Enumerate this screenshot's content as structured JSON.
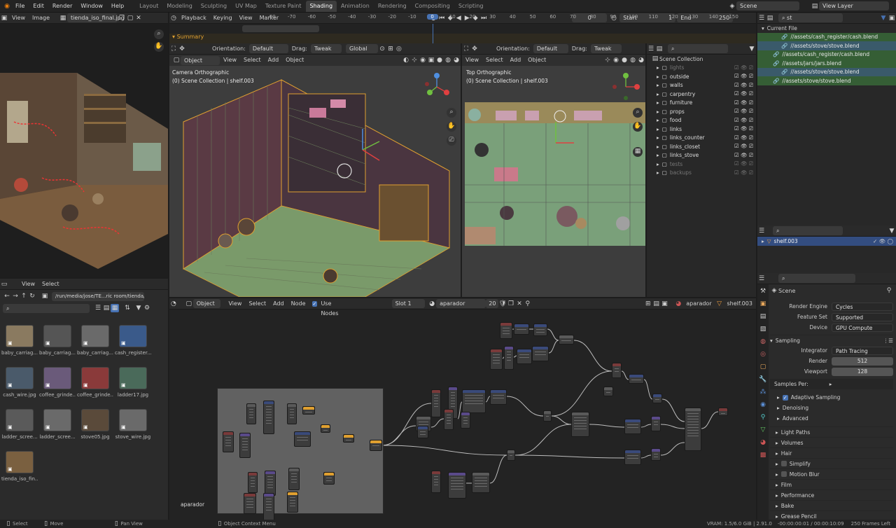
{
  "menubar": {
    "items": [
      "File",
      "Edit",
      "Render",
      "Window",
      "Help"
    ],
    "workspaces": [
      "Layout",
      "Modeling",
      "Sculpting",
      "UV Map",
      "Texture Paint",
      "Shading",
      "Animation",
      "Rendering",
      "Compositing",
      "Scripting"
    ],
    "active_workspace": "Shading",
    "scene": "Scene",
    "view_layer": "View Layer"
  },
  "image_editor": {
    "menus": [
      "View",
      "Image"
    ],
    "image_name": "tienda_iso_final.jpg"
  },
  "timeline": {
    "menus": [
      "Playback",
      "Keying",
      "View",
      "Marker"
    ],
    "current_frame": "0",
    "start_label": "Start",
    "start": "1",
    "end_label": "End",
    "end": "250",
    "ticks": [
      "-80",
      "-70",
      "-60",
      "-50",
      "-40",
      "-30",
      "-20",
      "-10",
      "0",
      "10",
      "20",
      "30",
      "40",
      "50",
      "60",
      "70",
      "80",
      "90",
      "100",
      "110",
      "120",
      "130",
      "140",
      "150"
    ],
    "playhead": "0",
    "summary": "Summary"
  },
  "viewport_left": {
    "orientation_label": "Orientation:",
    "orientation": "Default",
    "drag_label": "Drag:",
    "drag": "Tweak",
    "transform": "Global",
    "mode": "Object Mode",
    "menus": [
      "View",
      "Select",
      "Add",
      "Object"
    ],
    "view_name": "Camera Orthographic",
    "context": "(0) Scene Collection | shelf.003"
  },
  "viewport_right": {
    "orientation_label": "Orientation:",
    "orientation": "Default",
    "drag_label": "Drag:",
    "drag": "Tweak",
    "menus": [
      "View",
      "Select",
      "Add",
      "Object"
    ],
    "view_name": "Top Orthographic",
    "context": "(0) Scene Collection | shelf.003"
  },
  "outliner": {
    "root": "Scene Collection",
    "items": [
      {
        "name": "lights",
        "dim": true
      },
      {
        "name": "outside",
        "dim": false
      },
      {
        "name": "walls",
        "dim": false
      },
      {
        "name": "carpentry",
        "dim": false
      },
      {
        "name": "furniture",
        "dim": false
      },
      {
        "name": "props",
        "dim": false
      },
      {
        "name": "food",
        "dim": false
      },
      {
        "name": "links",
        "dim": false
      },
      {
        "name": "links_counter",
        "dim": false
      },
      {
        "name": "links_closet",
        "dim": false
      },
      {
        "name": "links_stove",
        "dim": false
      },
      {
        "name": "tests",
        "dim": true
      },
      {
        "name": "backups",
        "dim": true
      }
    ]
  },
  "blend_file_view": {
    "search": "st",
    "root": "Current File",
    "items": [
      {
        "text": "//assets/cash_register/cash.blend",
        "indent": 2,
        "highlight": true
      },
      {
        "text": "//assets/stove/stove.blend",
        "indent": 2,
        "highlight": false
      },
      {
        "text": "//assets/cash_register/cash.blend",
        "indent": 1,
        "highlight": true
      },
      {
        "text": "//assets/jars/jars.blend",
        "indent": 1,
        "highlight": true
      },
      {
        "text": "//assets/stove/stove.blend",
        "indent": 2,
        "highlight": false
      },
      {
        "text": "//assets/stove/stove.blend",
        "indent": 1,
        "highlight": true
      }
    ]
  },
  "object_panel": {
    "object": "shelf.003"
  },
  "properties": {
    "title": "Scene",
    "render_engine_label": "Render Engine",
    "render_engine": "Cycles",
    "feature_set_label": "Feature Set",
    "feature_set": "Supported",
    "device_label": "Device",
    "device": "GPU Compute",
    "sampling": "Sampling",
    "integrator_label": "Integrator",
    "integrator": "Path Tracing",
    "render_label": "Render",
    "render": "512",
    "viewport_label": "Viewport",
    "viewport": "128",
    "samples_per": "Samples Per:",
    "adaptive": "Adaptive Sampling",
    "denoising": "Denoising",
    "advanced": "Advanced",
    "sections": [
      "Light Paths",
      "Volumes",
      "Hair",
      "Simplify",
      "Motion Blur",
      "Film",
      "Performance",
      "Bake",
      "Grease Pencil"
    ]
  },
  "file_browser": {
    "menus": [
      "View",
      "Select"
    ],
    "path": "/run/media/jose/TE...ric room/tienda/rrss/",
    "files": [
      "baby_carriag...",
      "baby_carriag...",
      "baby_carriag...",
      "cash_register...",
      "cash_wire.jpg",
      "coffee_grinde...",
      "coffee_grinde...",
      "ladder17.jpg",
      "ladder_scree...",
      "ladder_scree...",
      "stove05.jpg",
      "stove_wire.jpg",
      "tienda_iso_fin..."
    ]
  },
  "node_editor": {
    "mode": "Object",
    "menus": [
      "View",
      "Select",
      "Add",
      "Node"
    ],
    "use_nodes": "Use Nodes",
    "slot": "Slot 1",
    "material": "aparador",
    "users": "20",
    "breadcrumb_material": "aparador",
    "breadcrumb_object": "shelf.003",
    "frame_label": "aparador"
  },
  "statusbar": {
    "select": "Select",
    "move": "Move",
    "pan": "Pan View",
    "context_menu": "Object Context Menu",
    "stats": "VRAM: 1.5/6.0 GiB | 2.91.0",
    "time": "-00:00:00:01 / 00:00:10:09",
    "frames_left": "250 Frames Left"
  },
  "colors": {
    "active_blue": "#4772b3",
    "highlight_green": "#355e35",
    "viewport_bg": "#3d3d3d",
    "node_bg": "#232323"
  }
}
